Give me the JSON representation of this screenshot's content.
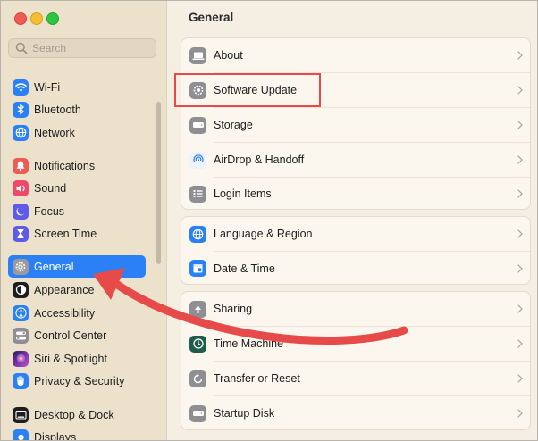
{
  "window": {
    "title": "General"
  },
  "search": {
    "placeholder": "Search"
  },
  "sidebar": {
    "items": [
      {
        "label": "Wi-Fi",
        "icon": "wifi-icon",
        "color": "#2a80f4"
      },
      {
        "label": "Bluetooth",
        "icon": "bluetooth-icon",
        "color": "#2a80f4"
      },
      {
        "label": "Network",
        "icon": "globe-icon",
        "color": "#2a80f4"
      },
      {
        "label": "Notifications",
        "icon": "bell-icon",
        "color": "#f05a55"
      },
      {
        "label": "Sound",
        "icon": "speaker-icon",
        "color": "#f0486b"
      },
      {
        "label": "Focus",
        "icon": "moon-icon",
        "color": "#5e5ce6"
      },
      {
        "label": "Screen Time",
        "icon": "hourglass-icon",
        "color": "#5e5ce6"
      },
      {
        "label": "General",
        "icon": "gear-icon",
        "color": "#8e8e93",
        "selected": true
      },
      {
        "label": "Appearance",
        "icon": "appearance-icon",
        "color": "#1d1d1f"
      },
      {
        "label": "Accessibility",
        "icon": "accessibility-icon",
        "color": "#2a80f4"
      },
      {
        "label": "Control Center",
        "icon": "toggles-icon",
        "color": "#8e8e93"
      },
      {
        "label": "Siri & Spotlight",
        "icon": "siri-icon",
        "color": "#c04cd9"
      },
      {
        "label": "Privacy & Security",
        "icon": "hand-icon",
        "color": "#2a80f4"
      },
      {
        "label": "Desktop & Dock",
        "icon": "dock-icon",
        "color": "#1d1d1f"
      },
      {
        "label": "Displays",
        "icon": "display-icon",
        "color": "#2a80f4"
      }
    ]
  },
  "main": {
    "groups": [
      {
        "rows": [
          {
            "label": "About",
            "icon": "laptop-icon"
          },
          {
            "label": "Software Update",
            "icon": "gear-badge-icon",
            "highlighted": true
          },
          {
            "label": "Storage",
            "icon": "drive-icon"
          },
          {
            "label": "AirDrop & Handoff",
            "icon": "airdrop-icon"
          },
          {
            "label": "Login Items",
            "icon": "list-icon"
          }
        ]
      },
      {
        "rows": [
          {
            "label": "Language & Region",
            "icon": "globe-icon"
          },
          {
            "label": "Date & Time",
            "icon": "calendar-icon"
          }
        ]
      },
      {
        "rows": [
          {
            "label": "Sharing",
            "icon": "sharing-icon"
          },
          {
            "label": "Time Machine",
            "icon": "time-machine-icon"
          },
          {
            "label": "Transfer or Reset",
            "icon": "reset-icon"
          },
          {
            "label": "Startup Disk",
            "icon": "disk-icon"
          }
        ]
      }
    ]
  },
  "annotation": {
    "color": "#e74b49"
  }
}
